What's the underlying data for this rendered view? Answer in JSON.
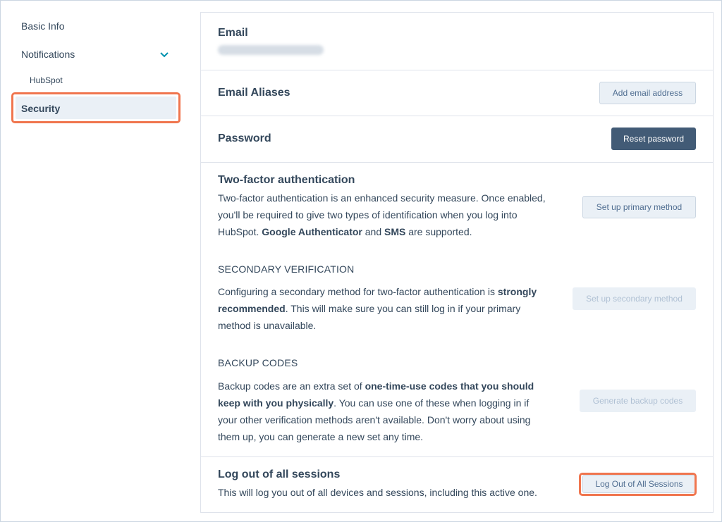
{
  "sidebar": {
    "items": [
      {
        "label": "Basic Info"
      },
      {
        "label": "Notifications"
      },
      {
        "label": "HubSpot"
      },
      {
        "label": "Security"
      }
    ]
  },
  "sections": {
    "email": {
      "title": "Email"
    },
    "aliases": {
      "title": "Email Aliases",
      "button": "Add email address"
    },
    "password": {
      "title": "Password",
      "button": "Reset password"
    },
    "twofa": {
      "title": "Two-factor authentication",
      "p1": "Two-factor authentication is an enhanced security measure. Once enabled, you'll be required to give two types of identification when you log into HubSpot.",
      "b1": "Google Authenticator",
      "p2": "and",
      "b2": "SMS",
      "p3": "are supported.",
      "button": "Set up primary method"
    },
    "secondary": {
      "title": "SECONDARY VERIFICATION",
      "p1": "Configuring a secondary method for two-factor authentication is",
      "b1": "strongly recommended",
      "p2": ". This will make sure you can still log in if your primary method is unavailable.",
      "button": "Set up secondary method"
    },
    "backup": {
      "title": "BACKUP CODES",
      "p1": "Backup codes are an extra set of",
      "b1": "one-time-use codes that you should keep with you physically",
      "p2": ". You can use one of these when logging in if your other verification methods aren't available. Don't worry about using them up, you can generate a new set any time.",
      "button": "Generate backup codes"
    },
    "logout": {
      "title": "Log out of all sessions",
      "desc": "This will log you out of all devices and sessions, including this active one.",
      "button": "Log Out of All Sessions"
    }
  },
  "colors": {
    "accent_outline": "#f0754e",
    "dark_button": "#425b76",
    "text": "#33475b"
  }
}
